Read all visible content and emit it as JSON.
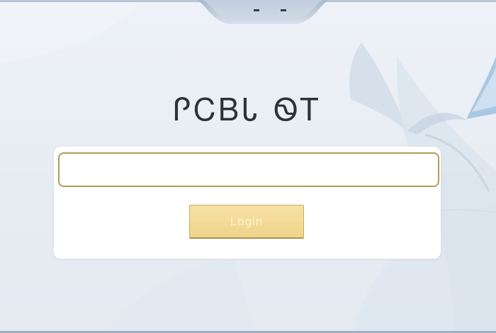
{
  "page": {
    "title": "ᎵᏟᏴᏓ ᏫᎢ",
    "background_color": "#e9eef5",
    "accent_color": "#b79a5c",
    "button_color": "#efd48a"
  },
  "login": {
    "input_value": "",
    "input_placeholder": "",
    "button_label": "Login"
  },
  "icons": {
    "top_notch": "window-notch-shape"
  }
}
